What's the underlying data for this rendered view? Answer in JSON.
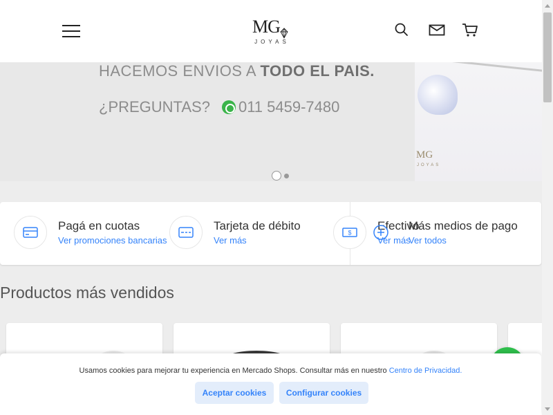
{
  "brand": {
    "logo_mark": "MG",
    "logo_sub": "JOYAS"
  },
  "banner": {
    "line1_prefix": "HACEMOS ENVIOS A ",
    "line1_bold": "TODO EL PAIS.",
    "line2_prefix": "¿PREGUNTAS?",
    "phone": "011 5459-7480",
    "mini_logo": "MG",
    "mini_logo_sub": "JOYAS",
    "carousel_current": 1,
    "carousel_total": 2
  },
  "payments": [
    {
      "title": "Pagá en cuotas",
      "link": "Ver promociones bancarias",
      "icon": "credit-card-icon"
    },
    {
      "title": "Tarjeta de débito",
      "link": "Ver más",
      "icon": "debit-card-icon"
    },
    {
      "title": "Efectivo",
      "link": "Ver más",
      "icon": "cash-icon"
    },
    {
      "title": "Más medios de pago",
      "link": "Ver todos",
      "icon": "plus-icon"
    }
  ],
  "section": {
    "title": "Productos más vendidos"
  },
  "cookie": {
    "text": "Usamos cookies para mejorar tu experiencia en Mercado Shops. Consultar más en nuestro ",
    "link": "Centro de Privacidad.",
    "accept": "Aceptar cookies",
    "configure": "Configurar cookies"
  },
  "colors": {
    "accent": "#3483fa",
    "whatsapp": "#2fbf4c",
    "page_bg": "#ededed"
  }
}
